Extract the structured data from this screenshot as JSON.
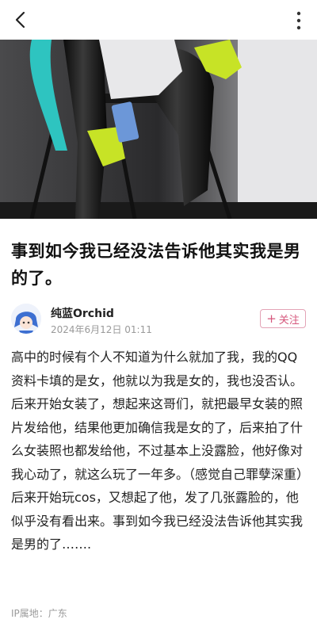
{
  "header": {
    "back_icon": "chevron-left-icon",
    "more_icon": "vertical-dots-icon"
  },
  "post": {
    "title": "事到如今我已经没法告诉他其实我是男的了。",
    "author": "纯蓝Orchid",
    "date": "2024年6月12日 01:11",
    "follow_label": "关注",
    "paragraphs": [
      "高中的时候有个人不知道为什么就加了我，我的QQ资料卡填的是女，他就以为我是女的，我也没否认。后来开始女装了，想起来这哥们，就把最早女装的照片发给他，结果他更加确信我是女的了，后来拍了什么女装照也都发给他，不过基本上没露脸，他好像对我心动了，就这么玩了一年多。（感觉自己罪孽深重）",
      "后来开始玩cos，又想起了他，发了几张露脸的，他似乎没有看出来。事到如今我已经没法告诉他其实我是男的了……."
    ],
    "ip_location": "IP属地：广东"
  },
  "colors": {
    "accent": "#d6577c",
    "muted": "#9a9a9a"
  }
}
